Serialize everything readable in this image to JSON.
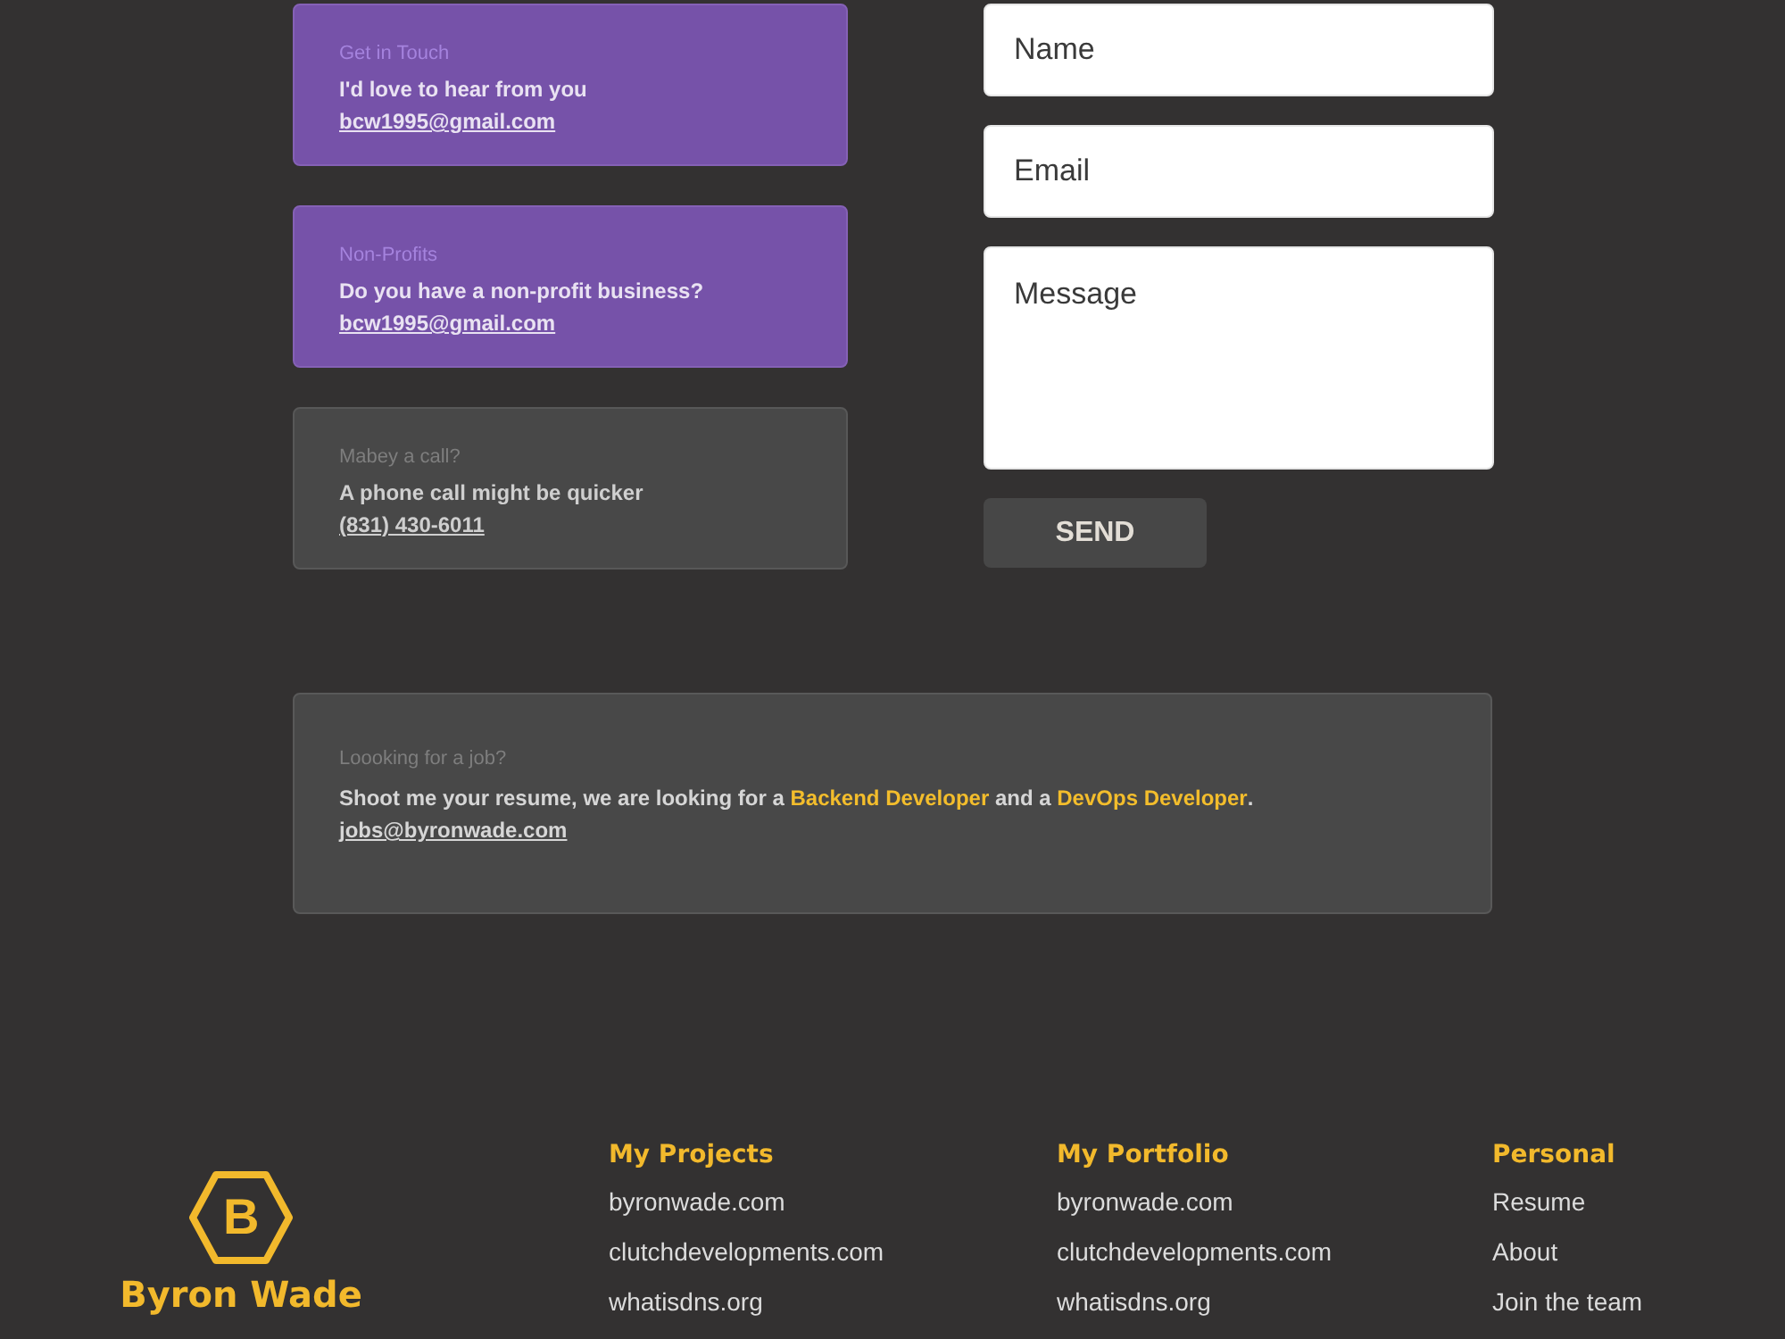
{
  "contact_cards": [
    {
      "kind": "accent",
      "label": "Get in Touch",
      "text": "I'd love to hear from you",
      "link": "bcw1995@gmail.com"
    },
    {
      "kind": "accent",
      "label": "Non-Profits",
      "text": "Do you have a non-profit business?",
      "link": "bcw1995@gmail.com"
    },
    {
      "kind": "muted",
      "label": "Mabey a call?",
      "text": "A phone call might be quicker",
      "link": "(831) 430-6011"
    }
  ],
  "form": {
    "fields": [
      {
        "kind": "input",
        "placeholder": "Name"
      },
      {
        "kind": "input",
        "placeholder": "Email"
      },
      {
        "kind": "textarea",
        "placeholder": "Message"
      }
    ],
    "button": "SEND"
  },
  "job_card": {
    "label": "Loooking for a job?",
    "text": "Shoot me your resume, we are looking for a **Backend Developer** and a **DevOps Developer**.",
    "link": "jobs@byronwade.com"
  },
  "footer": {
    "logo": {
      "mark": "B",
      "name": "Byron Wade"
    },
    "columns": [
      {
        "title": "My Projects",
        "links": [
          "byronwade.com",
          "clutchdevelopments.com",
          "whatisdns.org"
        ]
      },
      {
        "title": "My Portfolio",
        "links": [
          "byronwade.com",
          "clutchdevelopments.com",
          "whatisdns.org"
        ]
      },
      {
        "title": "Personal",
        "links": [
          "Resume",
          "About",
          "Join the team"
        ]
      }
    ]
  }
}
